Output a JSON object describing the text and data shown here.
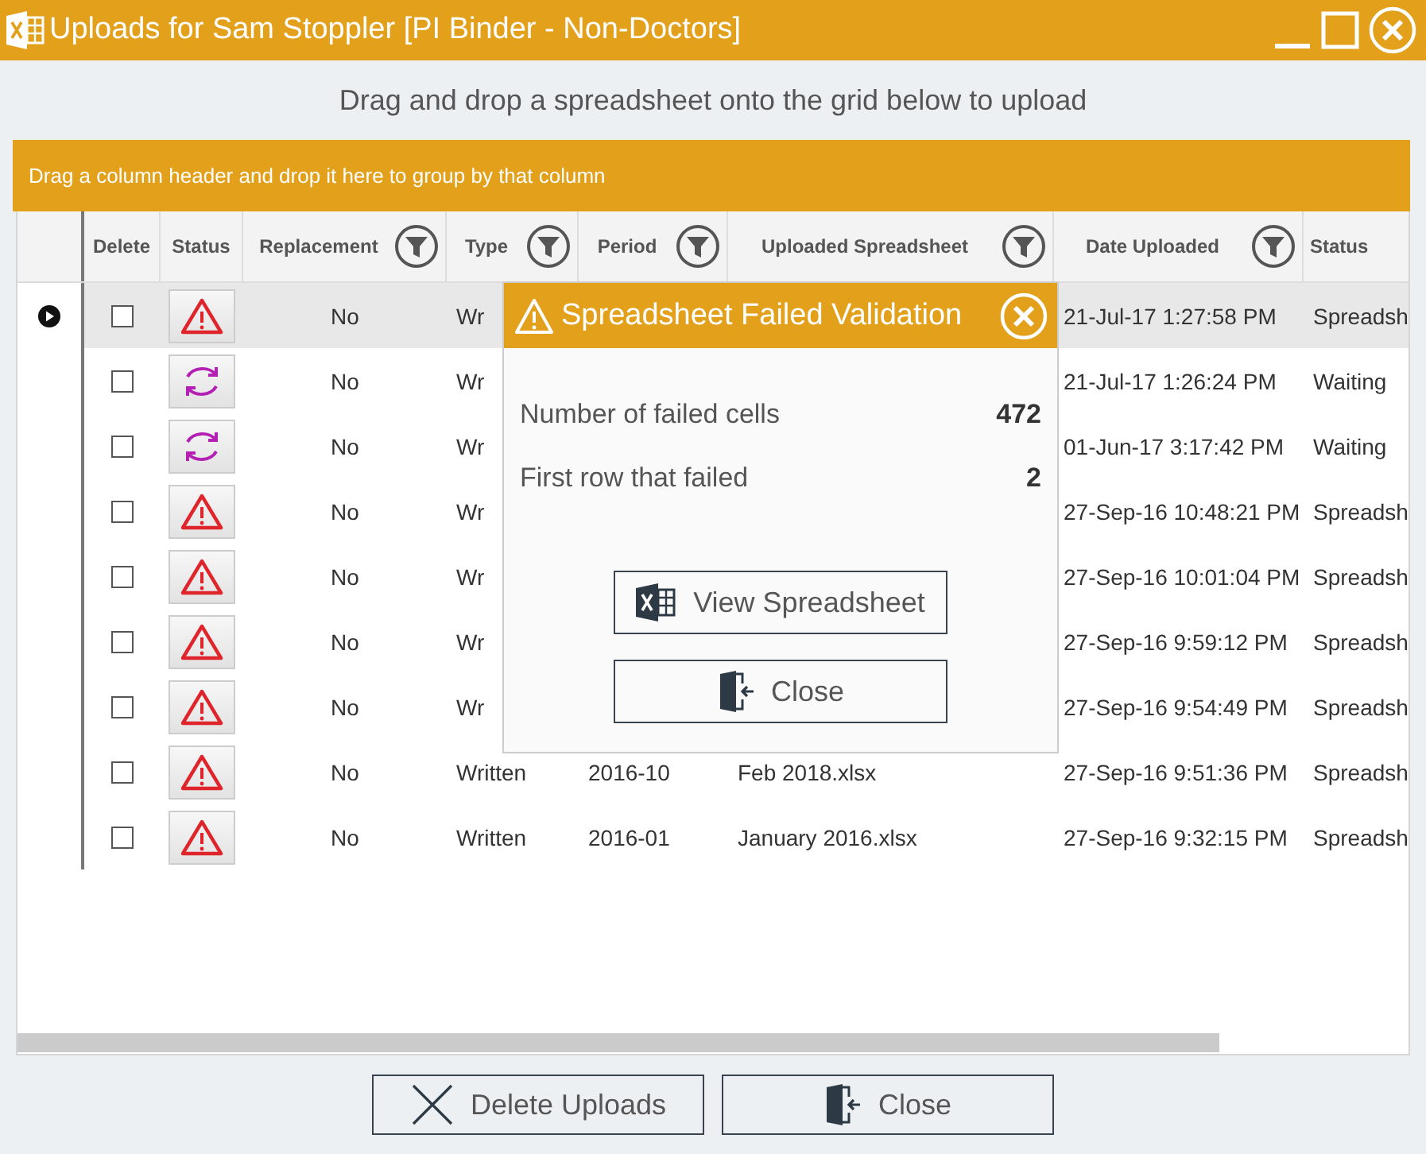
{
  "window": {
    "title": "Uploads for Sam Stoppler [PI Binder - Non-Doctors]"
  },
  "instructions": "Drag and drop a spreadsheet onto the grid below to upload",
  "group_panel": {
    "text": "Drag a column header and drop it here to group by that column"
  },
  "table": {
    "columns": [
      {
        "label": "Delete",
        "filter": false
      },
      {
        "label": "Status",
        "filter": false
      },
      {
        "label": "Replacement",
        "filter": true
      },
      {
        "label": "Type",
        "filter": true
      },
      {
        "label": "Period",
        "filter": true
      },
      {
        "label": "Uploaded Spreadsheet",
        "filter": true
      },
      {
        "label": "Date Uploaded",
        "filter": true
      },
      {
        "label": "Status",
        "filter": false
      }
    ],
    "rows": [
      {
        "selected": true,
        "checked": false,
        "kind": "error",
        "replacement": "No",
        "type": "Wr",
        "date_uploaded": "21-Jul-17 1:27:58 PM",
        "status": "Spreadsh"
      },
      {
        "selected": false,
        "checked": false,
        "kind": "pending",
        "replacement": "No",
        "type": "Wr",
        "date_uploaded": "21-Jul-17 1:26:24 PM",
        "status": "Waiting"
      },
      {
        "selected": false,
        "checked": false,
        "kind": "pending",
        "replacement": "No",
        "type": "Wr",
        "date_uploaded": "01-Jun-17 3:17:42 PM",
        "status": "Waiting"
      },
      {
        "selected": false,
        "checked": false,
        "kind": "error",
        "replacement": "No",
        "type": "Wr",
        "date_uploaded": "27-Sep-16 10:48:21 PM",
        "status": "Spreadsh"
      },
      {
        "selected": false,
        "checked": false,
        "kind": "error",
        "replacement": "No",
        "type": "Wr",
        "date_uploaded": "27-Sep-16 10:01:04 PM",
        "status": "Spreadsh"
      },
      {
        "selected": false,
        "checked": false,
        "kind": "error",
        "replacement": "No",
        "type": "Wr",
        "date_uploaded": "27-Sep-16 9:59:12 PM",
        "status": "Spreadsh"
      },
      {
        "selected": false,
        "checked": false,
        "kind": "error",
        "replacement": "No",
        "type": "Wr",
        "date_uploaded": "27-Sep-16 9:54:49 PM",
        "status": "Spreadsh"
      },
      {
        "selected": false,
        "checked": false,
        "kind": "error",
        "replacement": "No",
        "type": "Written",
        "period": "2016-10",
        "uploaded_spreadsheet": "Feb 2018.xlsx",
        "date_uploaded": "27-Sep-16 9:51:36 PM",
        "status": "Spreadsh"
      },
      {
        "selected": false,
        "checked": false,
        "kind": "error",
        "replacement": "No",
        "type": "Written",
        "period": "2016-01",
        "uploaded_spreadsheet": "January 2016.xlsx",
        "date_uploaded": "27-Sep-16 9:32:15 PM",
        "status": "Spreadsh"
      }
    ]
  },
  "dialog": {
    "title": "Spreadsheet Failed Validation",
    "fields": [
      {
        "label": "Number of failed cells",
        "value": "472"
      },
      {
        "label": "First row that failed",
        "value": "2"
      }
    ],
    "buttons": [
      {
        "label": "View Spreadsheet"
      },
      {
        "label": "Close"
      }
    ]
  },
  "buttons": [
    {
      "label": "Delete Uploads"
    },
    {
      "label": "Close"
    }
  ]
}
